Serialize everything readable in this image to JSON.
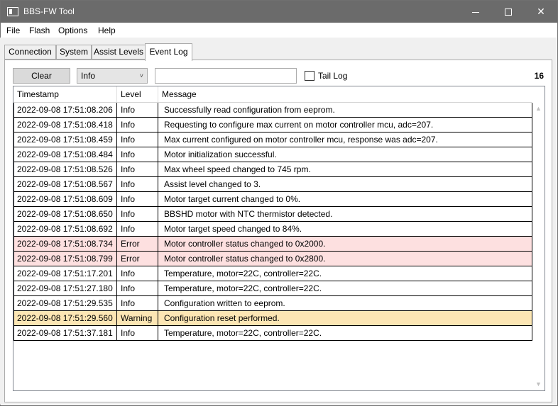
{
  "window": {
    "title": "BBS-FW Tool"
  },
  "menu": [
    "File",
    "Flash",
    "Options",
    "Help"
  ],
  "tabs": [
    "Connection",
    "System",
    "Assist Levels",
    "Event Log"
  ],
  "toolbar": {
    "clear_label": "Clear",
    "level_selected": "Info",
    "filter_value": "",
    "filter_placeholder": "",
    "tail_log_label": "Tail Log",
    "tail_log_checked": false,
    "event_count": "16"
  },
  "grid": {
    "columns": [
      "Timestamp",
      "Level",
      "Message"
    ],
    "rows": [
      {
        "ts": "2022-09-08 17:51:08.206",
        "level": "Info",
        "msg": "Successfully read configuration from eeprom."
      },
      {
        "ts": "2022-09-08 17:51:08.418",
        "level": "Info",
        "msg": "Requesting to configure max current on motor controller mcu, adc=207."
      },
      {
        "ts": "2022-09-08 17:51:08.459",
        "level": "Info",
        "msg": "Max current configured on motor controller mcu, response was adc=207."
      },
      {
        "ts": "2022-09-08 17:51:08.484",
        "level": "Info",
        "msg": "Motor initialization successful."
      },
      {
        "ts": "2022-09-08 17:51:08.526",
        "level": "Info",
        "msg": "Max wheel speed changed to 745 rpm."
      },
      {
        "ts": "2022-09-08 17:51:08.567",
        "level": "Info",
        "msg": "Assist level changed to 3."
      },
      {
        "ts": "2022-09-08 17:51:08.609",
        "level": "Info",
        "msg": "Motor target current changed to 0%."
      },
      {
        "ts": "2022-09-08 17:51:08.650",
        "level": "Info",
        "msg": "BBSHD motor with NTC thermistor detected."
      },
      {
        "ts": "2022-09-08 17:51:08.692",
        "level": "Info",
        "msg": "Motor target speed changed to 84%."
      },
      {
        "ts": "2022-09-08 17:51:08.734",
        "level": "Error",
        "msg": "Motor controller status changed to 0x2000."
      },
      {
        "ts": "2022-09-08 17:51:08.799",
        "level": "Error",
        "msg": "Motor controller status changed to 0x2800."
      },
      {
        "ts": "2022-09-08 17:51:17.201",
        "level": "Info",
        "msg": "Temperature, motor=22C, controller=22C."
      },
      {
        "ts": "2022-09-08 17:51:27.180",
        "level": "Info",
        "msg": "Temperature, motor=22C, controller=22C."
      },
      {
        "ts": "2022-09-08 17:51:29.535",
        "level": "Info",
        "msg": "Configuration written to eeprom."
      },
      {
        "ts": "2022-09-08 17:51:29.560",
        "level": "Warning",
        "msg": "Configuration reset performed."
      },
      {
        "ts": "2022-09-08 17:51:37.181",
        "level": "Info",
        "msg": "Temperature, motor=22C, controller=22C."
      }
    ]
  },
  "colors": {
    "error_row": "#fde0e0",
    "warning_row": "#fce6b4",
    "titlebar": "#6b6b6b"
  },
  "icons": {
    "app": "app-window-icon",
    "minimize": "minimize-icon",
    "maximize": "maximize-icon",
    "close": "close-icon",
    "dropdown": "chevron-down-icon"
  }
}
